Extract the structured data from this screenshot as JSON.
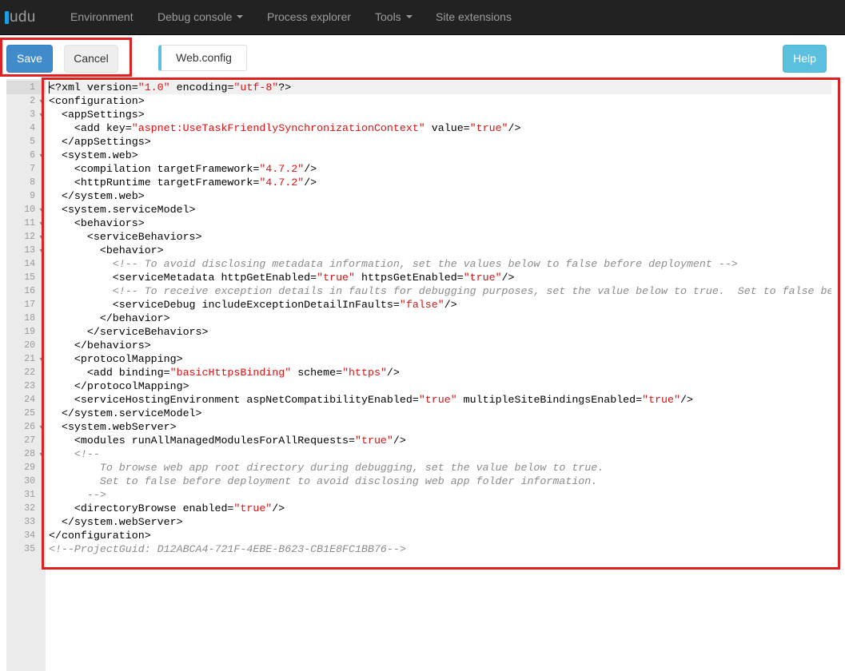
{
  "navbar": {
    "brand": "udu",
    "items": [
      "Environment",
      "Debug console",
      "Process explorer",
      "Tools",
      "Site extensions"
    ]
  },
  "toolbar": {
    "save_label": "Save",
    "cancel_label": "Cancel",
    "file_tab": "Web.config",
    "help_label": "Help"
  },
  "editor": {
    "language": "xml",
    "active_line": 1,
    "lines": [
      [
        [
          "pi",
          "<?xml version="
        ],
        [
          "s",
          "\"1.0\""
        ],
        [
          "t",
          " encoding="
        ],
        [
          "s",
          "\"utf-8\""
        ],
        [
          "t",
          "?>"
        ]
      ],
      [
        [
          "t",
          "<configuration>"
        ]
      ],
      [
        [
          "t",
          "  <appSettings>"
        ]
      ],
      [
        [
          "t",
          "    <add key="
        ],
        [
          "s",
          "\"aspnet:UseTaskFriendlySynchronizationContext\""
        ],
        [
          "t",
          " value="
        ],
        [
          "s",
          "\"true\""
        ],
        [
          "t",
          "/>"
        ]
      ],
      [
        [
          "t",
          "  </appSettings>"
        ]
      ],
      [
        [
          "t",
          "  <system.web>"
        ]
      ],
      [
        [
          "t",
          "    <compilation targetFramework="
        ],
        [
          "s",
          "\"4.7.2\""
        ],
        [
          "t",
          "/>"
        ]
      ],
      [
        [
          "t",
          "    <httpRuntime targetFramework="
        ],
        [
          "s",
          "\"4.7.2\""
        ],
        [
          "t",
          "/>"
        ]
      ],
      [
        [
          "t",
          "  </system.web>"
        ]
      ],
      [
        [
          "t",
          "  <system.serviceModel>"
        ]
      ],
      [
        [
          "t",
          "    <behaviors>"
        ]
      ],
      [
        [
          "t",
          "      <serviceBehaviors>"
        ]
      ],
      [
        [
          "t",
          "        <behavior>"
        ]
      ],
      [
        [
          "t",
          "          "
        ],
        [
          "c",
          "<!-- To avoid disclosing metadata information, set the values below to false before deployment -->"
        ]
      ],
      [
        [
          "t",
          "          <serviceMetadata httpGetEnabled="
        ],
        [
          "s",
          "\"true\""
        ],
        [
          "t",
          " httpsGetEnabled="
        ],
        [
          "s",
          "\"true\""
        ],
        [
          "t",
          "/>"
        ]
      ],
      [
        [
          "t",
          "          "
        ],
        [
          "c",
          "<!-- To receive exception details in faults for debugging purposes, set the value below to true.  Set to false before"
        ]
      ],
      [
        [
          "t",
          "          <serviceDebug includeExceptionDetailInFaults="
        ],
        [
          "s",
          "\"false\""
        ],
        [
          "t",
          "/>"
        ]
      ],
      [
        [
          "t",
          "        </behavior>"
        ]
      ],
      [
        [
          "t",
          "      </serviceBehaviors>"
        ]
      ],
      [
        [
          "t",
          "    </behaviors>"
        ]
      ],
      [
        [
          "t",
          "    <protocolMapping>"
        ]
      ],
      [
        [
          "t",
          "      <add binding="
        ],
        [
          "s",
          "\"basicHttpsBinding\""
        ],
        [
          "t",
          " scheme="
        ],
        [
          "s",
          "\"https\""
        ],
        [
          "t",
          "/>"
        ]
      ],
      [
        [
          "t",
          "    </protocolMapping>"
        ]
      ],
      [
        [
          "t",
          "    <serviceHostingEnvironment aspNetCompatibilityEnabled="
        ],
        [
          "s",
          "\"true\""
        ],
        [
          "t",
          " multipleSiteBindingsEnabled="
        ],
        [
          "s",
          "\"true\""
        ],
        [
          "t",
          "/>"
        ]
      ],
      [
        [
          "t",
          "  </system.serviceModel>"
        ]
      ],
      [
        [
          "t",
          "  <system.webServer>"
        ]
      ],
      [
        [
          "t",
          "    <modules runAllManagedModulesForAllRequests="
        ],
        [
          "s",
          "\"true\""
        ],
        [
          "t",
          "/>"
        ]
      ],
      [
        [
          "t",
          "    "
        ],
        [
          "c",
          "<!--"
        ]
      ],
      [
        [
          "c",
          "        To browse web app root directory during debugging, set the value below to true."
        ]
      ],
      [
        [
          "c",
          "        Set to false before deployment to avoid disclosing web app folder information."
        ]
      ],
      [
        [
          "c",
          "      -->"
        ]
      ],
      [
        [
          "t",
          "    <directoryBrowse enabled="
        ],
        [
          "s",
          "\"true\""
        ],
        [
          "t",
          "/>"
        ]
      ],
      [
        [
          "t",
          "  </system.webServer>"
        ]
      ],
      [
        [
          "t",
          "</configuration>"
        ]
      ],
      [
        [
          "c",
          "<!--ProjectGuid: D12ABCA4-721F-4EBE-B623-CB1E8FC1BB76-->"
        ]
      ]
    ],
    "fold_lines": [
      2,
      3,
      6,
      10,
      11,
      12,
      13,
      21,
      26,
      28
    ]
  }
}
